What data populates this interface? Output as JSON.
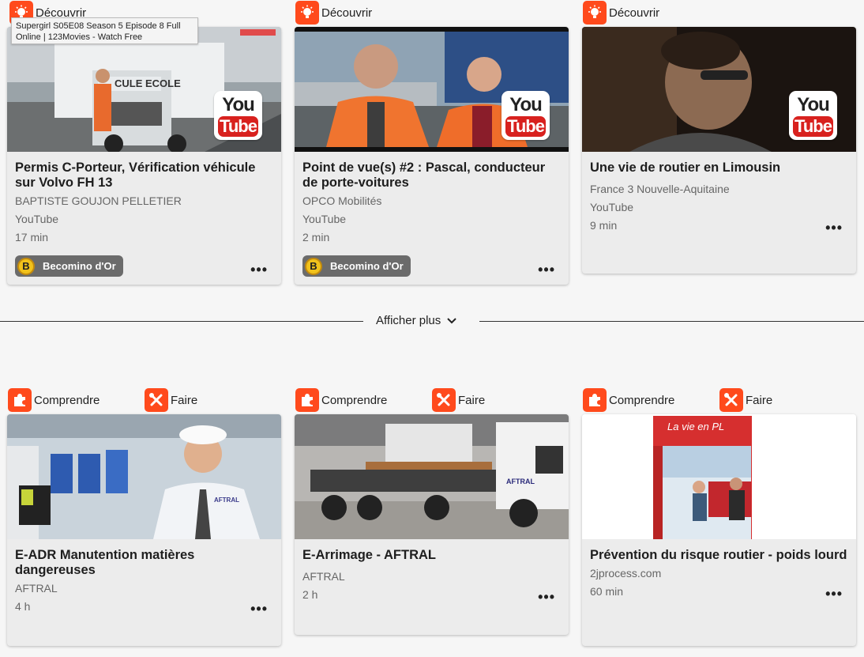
{
  "tags": {
    "decouvrir": "Découvrir",
    "comprendre": "Comprendre",
    "faire": "Faire"
  },
  "tooltip": "Supergirl S05E08 Season 5 Episode 8 Full Online | 123Movies - Watch Free",
  "show_more": "Afficher plus",
  "youtube_logo": {
    "you": "You",
    "tube": "Tube"
  },
  "cards_top": [
    {
      "title": "Permis C-Porteur, Vérification véhicule sur Volvo FH 13",
      "author": "BAPTISTE GOUJON PELLETIER",
      "source": "YouTube",
      "duration": "17 min",
      "badge": "Becomino d'Or",
      "thumb_text": "CULE ECOLE"
    },
    {
      "title": "Point de vue(s) #2 : Pascal, conducteur de porte-voitures",
      "author": "OPCO Mobilités",
      "source": "YouTube",
      "duration": "2 min",
      "badge": "Becomino d'Or"
    },
    {
      "title": "Une vie de routier en Limousin",
      "author": "France 3 Nouvelle-Aquitaine",
      "source": "YouTube",
      "duration": "9 min"
    }
  ],
  "cards_bottom": [
    {
      "title": "E-ADR Manutention matières dangereuses",
      "author": "AFTRAL",
      "duration": "4 h",
      "thumb_text": "AFTRAL"
    },
    {
      "title": "E-Arrimage - AFTRAL",
      "author": "AFTRAL",
      "duration": "2 h",
      "thumb_text": "AFTRAL"
    },
    {
      "title": "Prévention du risque routier - poids lourd",
      "author": "2jprocess.com",
      "duration": "60 min",
      "thumb_text": "La vie en PL"
    }
  ],
  "badge_coin": "B",
  "more_glyph": "•••",
  "colors": {
    "accent": "#ff4a1c",
    "youtube_red": "#d8211e",
    "badge_bg": "#6b6b6b",
    "coin": "#f1c21b"
  }
}
